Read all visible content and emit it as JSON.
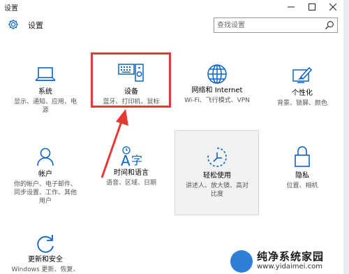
{
  "window": {
    "title": "设置"
  },
  "header": {
    "title": "设置"
  },
  "search": {
    "placeholder": "查找设置"
  },
  "accent": "#0a64c8",
  "highlight_color": "#e53935",
  "tiles": [
    {
      "name": "系统",
      "desc": "显示、通知、应用、电\n源",
      "icon": "laptop-icon"
    },
    {
      "name": "设备",
      "desc": "蓝牙、打印机、鼠标",
      "icon": "devices-icon"
    },
    {
      "name": "网络和 Internet",
      "desc": "Wi-Fi、飞行模式、VPN",
      "icon": "globe-icon"
    },
    {
      "name": "个性化",
      "desc": "背景、锁屏、颜色",
      "icon": "personalization-icon"
    },
    {
      "name": "帐户",
      "desc": "你的帐户、电子邮件、\n同步设置、工作、其他\n用户",
      "icon": "person-icon"
    },
    {
      "name": "时间和语言",
      "desc": "语音、区域、日期",
      "icon": "time-language-icon"
    },
    {
      "name": "轻松使用",
      "desc": "讲述人、放大镜、高对\n比度",
      "icon": "ease-of-access-icon"
    },
    {
      "name": "隐私",
      "desc": "位置、相机",
      "icon": "lock-icon"
    },
    {
      "name": "更新和安全",
      "desc": "Windows 更新、恢复、",
      "icon": "update-icon"
    }
  ],
  "watermark": {
    "text": "纯净系统家园",
    "url": "www.yidaimei.com"
  }
}
